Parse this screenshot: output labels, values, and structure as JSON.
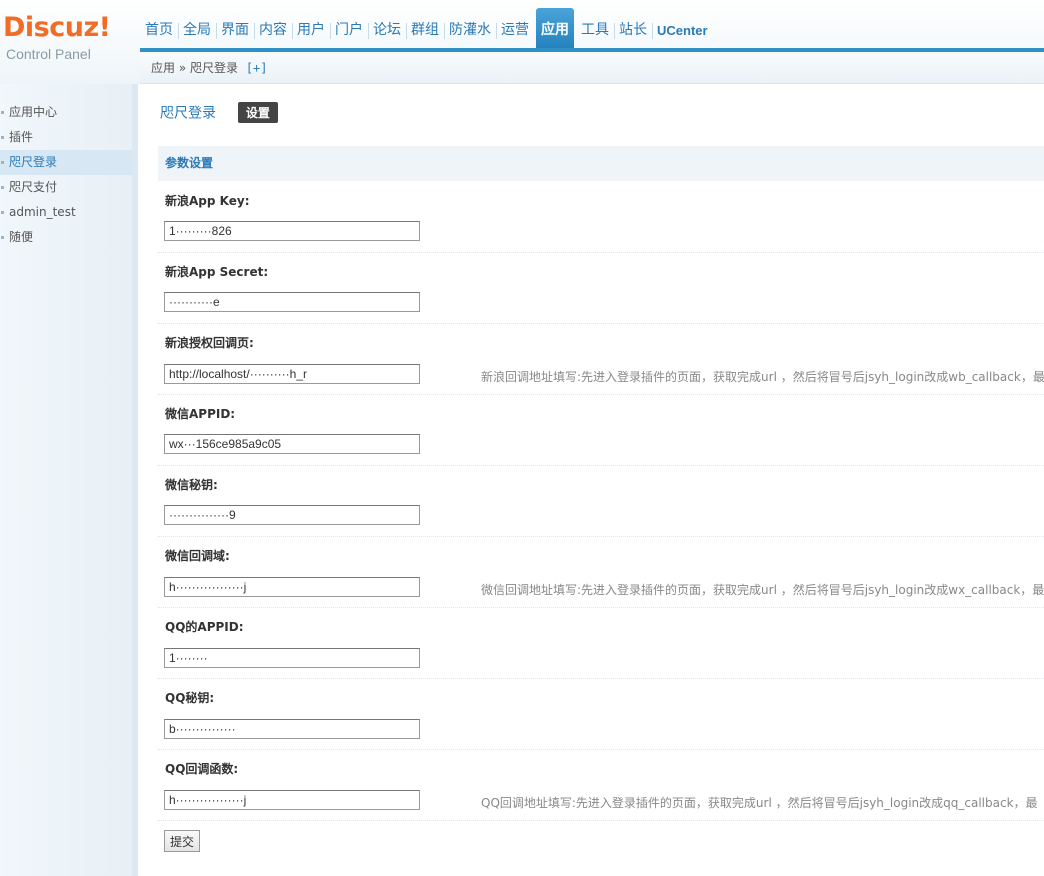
{
  "logo": {
    "brand": "Discuz!",
    "subtitle": "Control Panel"
  },
  "topnav": {
    "items": [
      "首页",
      "全局",
      "界面",
      "内容",
      "用户",
      "门户",
      "论坛",
      "群组",
      "防灌水",
      "运营",
      "应用",
      "工具",
      "站长",
      "UCenter"
    ],
    "active": "应用"
  },
  "breadcrumb": {
    "text": "应用 » 咫尺登录",
    "add": "[+]"
  },
  "sidebar": {
    "items": [
      "应用中心",
      "插件",
      "咫尺登录",
      "咫尺支付",
      "admin_test",
      "随便"
    ],
    "current": "咫尺登录"
  },
  "main": {
    "title": "咫尺登录",
    "settings_button": "设置",
    "section": "参数设置",
    "fields": [
      {
        "label": "新浪App Key:",
        "value": "1·········826",
        "hint": ""
      },
      {
        "label": "新浪App Secret:",
        "value": "···········e",
        "hint": ""
      },
      {
        "label": "新浪授权回调页:",
        "value": "http://localhost/··········h_r",
        "hint": "新浪回调地址填写:先进入登录插件的页面，获取完成url ，然后将冒号后jsyh_login改成wb_callback，最"
      },
      {
        "label": "微信APPID:",
        "value": "wx···156ce985a9c05",
        "hint": ""
      },
      {
        "label": "微信秘钥:",
        "value": "···············9",
        "hint": ""
      },
      {
        "label": "微信回调域:",
        "value": "h·················j",
        "hint": "微信回调地址填写:先进入登录插件的页面，获取完成url ，然后将冒号后jsyh_login改成wx_callback，最"
      },
      {
        "label": "QQ的APPID:",
        "value": "1········",
        "hint": ""
      },
      {
        "label": "QQ秘钥:",
        "value": "b···············",
        "hint": ""
      },
      {
        "label": "QQ回调函数:",
        "value": "h·················j",
        "hint": "QQ回调地址填写:先进入登录插件的页面，获取完成url ，然后将冒号后jsyh_login改成qq_callback，最"
      }
    ],
    "submit": "提交"
  }
}
